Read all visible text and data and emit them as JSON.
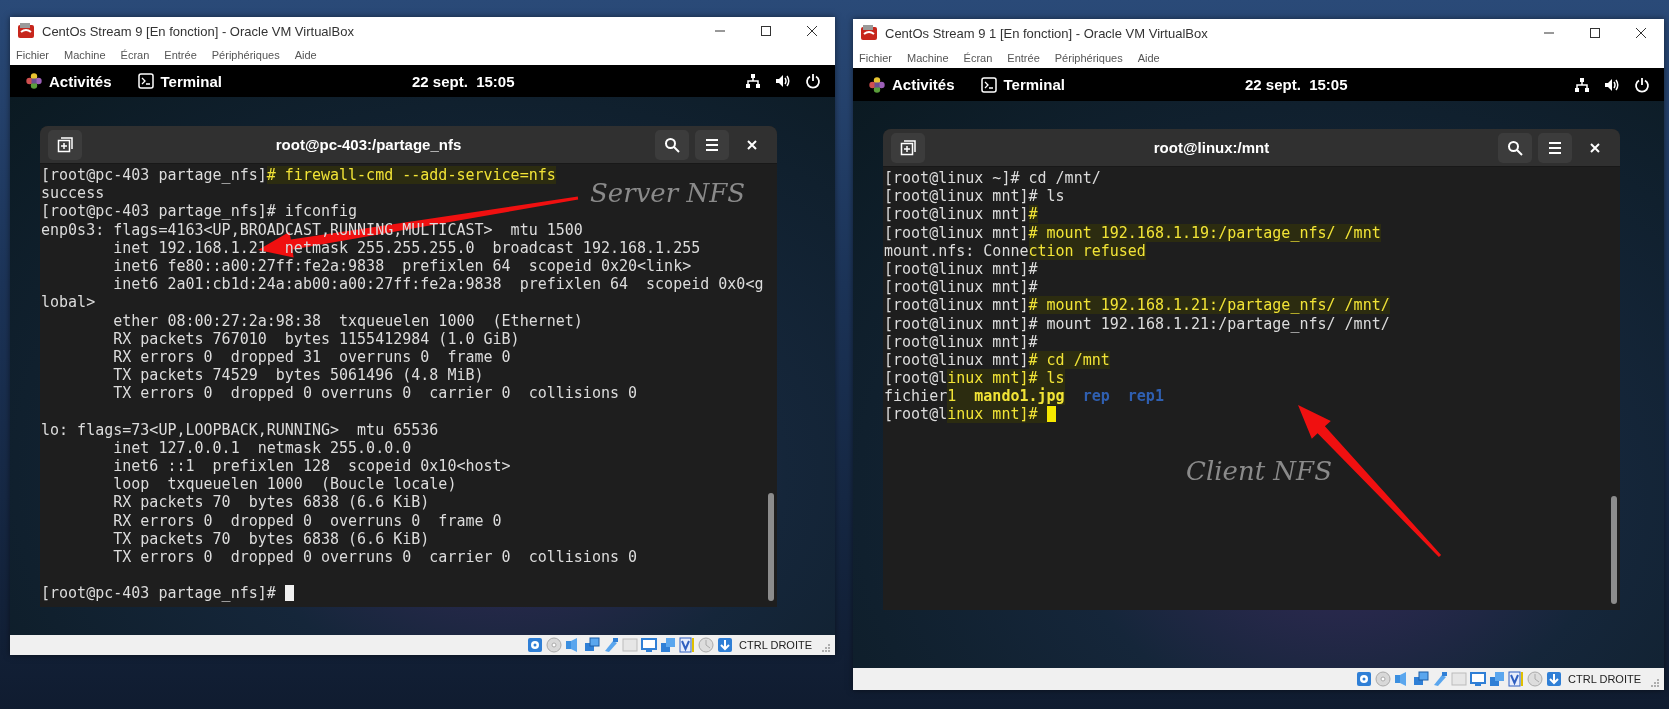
{
  "windows": [
    {
      "title": "CentOs Stream 9 [En fonction] - Oracle VM VirtualBox",
      "menu": [
        "Fichier",
        "Machine",
        "Écran",
        "Entrée",
        "Périphériques",
        "Aide"
      ],
      "top_bar": {
        "activities": "Activités",
        "app": "Terminal",
        "clock": "22 sept.  15:05"
      },
      "terminal": {
        "title": "root@pc-403:/partage_nfs",
        "lines": [
          {
            "kind": "parts",
            "parts": [
              {
                "text": "[root@pc-403 partage_nfs]",
                "kind": "text",
                "marked": false
              },
              {
                "text": "# firewall-cmd --add-service=nfs",
                "kind": "text",
                "marked": true
              }
            ]
          },
          {
            "kind": "plain",
            "text": "success"
          },
          {
            "kind": "plain",
            "text": "[root@pc-403 partage_nfs]# ifconfig"
          },
          {
            "kind": "plain",
            "text": "enp0s3: flags=4163<UP,BROADCAST,RUNNING,MULTICAST>  mtu 1500"
          },
          {
            "kind": "plain",
            "text": "        inet 192.168.1.21  netmask 255.255.255.0  broadcast 192.168.1.255"
          },
          {
            "kind": "plain",
            "text": "        inet6 fe80::a00:27ff:fe2a:9838  prefixlen 64  scopeid 0x20<link>"
          },
          {
            "kind": "plain",
            "text": "        inet6 2a01:cb1d:24a:ab00:a00:27ff:fe2a:9838  prefixlen 64  scopeid 0x0<g"
          },
          {
            "kind": "plain",
            "text": "lobal>"
          },
          {
            "kind": "plain",
            "text": "        ether 08:00:27:2a:98:38  txqueuelen 1000  (Ethernet)"
          },
          {
            "kind": "plain",
            "text": "        RX packets 767010  bytes 1155412984 (1.0 GiB)"
          },
          {
            "kind": "plain",
            "text": "        RX errors 0  dropped 31  overruns 0  frame 0"
          },
          {
            "kind": "plain",
            "text": "        TX packets 74529  bytes 5061496 (4.8 MiB)"
          },
          {
            "kind": "plain",
            "text": "        TX errors 0  dropped 0 overruns 0  carrier 0  collisions 0"
          },
          {
            "kind": "blank"
          },
          {
            "kind": "plain",
            "text": "lo: flags=73<UP,LOOPBACK,RUNNING>  mtu 65536"
          },
          {
            "kind": "plain",
            "text": "        inet 127.0.0.1  netmask 255.0.0.0"
          },
          {
            "kind": "plain",
            "text": "        inet6 ::1  prefixlen 128  scopeid 0x10<host>"
          },
          {
            "kind": "plain",
            "text": "        loop  txqueuelen 1000  (Boucle locale)"
          },
          {
            "kind": "plain",
            "text": "        RX packets 70  bytes 6838 (6.6 KiB)"
          },
          {
            "kind": "plain",
            "text": "        RX errors 0  dropped 0  overruns 0  frame 0"
          },
          {
            "kind": "plain",
            "text": "        TX packets 70  bytes 6838 (6.6 KiB)"
          },
          {
            "kind": "plain",
            "text": "        TX errors 0  dropped 0 overruns 0  carrier 0  collisions 0"
          },
          {
            "kind": "blank"
          },
          {
            "kind": "parts",
            "parts": [
              {
                "text": "[root@pc-403 partage_nfs]# ",
                "kind": "text",
                "marked": false
              },
              {
                "kind": "cursor",
                "marked": false
              }
            ]
          }
        ]
      },
      "annotation": {
        "text": "Server NFS"
      },
      "status_bar": {
        "host_key": "CTRL DROITE"
      }
    },
    {
      "title": "CentOs Stream 9 1 [En fonction] - Oracle VM VirtualBox",
      "menu": [
        "Fichier",
        "Machine",
        "Écran",
        "Entrée",
        "Périphériques",
        "Aide"
      ],
      "top_bar": {
        "activities": "Activités",
        "app": "Terminal",
        "clock": "22 sept.  15:05"
      },
      "terminal": {
        "title": "root@linux:/mnt",
        "lines": [
          {
            "kind": "plain",
            "text": "[root@linux ~]# cd /mnt/"
          },
          {
            "kind": "plain",
            "text": "[root@linux mnt]# ls"
          },
          {
            "kind": "parts",
            "parts": [
              {
                "text": "[root@linux mnt]",
                "kind": "text",
                "marked": false
              },
              {
                "text": "#",
                "kind": "text",
                "marked": true
              }
            ]
          },
          {
            "kind": "parts",
            "parts": [
              {
                "text": "[root@linux mnt]",
                "kind": "text",
                "marked": false
              },
              {
                "text": "# mount 192.168.1.19:/partage_nfs/ /mnt",
                "kind": "text",
                "marked": true
              }
            ]
          },
          {
            "kind": "parts",
            "parts": [
              {
                "text": "mount.nfs: Conne",
                "kind": "text",
                "marked": false
              },
              {
                "text": "ction refused",
                "kind": "text",
                "marked": true
              }
            ]
          },
          {
            "kind": "plain",
            "text": "[root@linux mnt]#"
          },
          {
            "kind": "plain",
            "text": "[root@linux mnt]#"
          },
          {
            "kind": "parts",
            "parts": [
              {
                "text": "[root@linux mnt]",
                "kind": "text",
                "marked": false
              },
              {
                "text": "# mount 192.168.1.21:/partage_nfs/ /mnt/",
                "kind": "text",
                "marked": true
              }
            ]
          },
          {
            "kind": "plain",
            "text": "[root@linux mnt]# mount 192.168.1.21:/partage_nfs/ /mnt/"
          },
          {
            "kind": "plain",
            "text": "[root@linux mnt]#"
          },
          {
            "kind": "parts",
            "parts": [
              {
                "text": "[root@linux mnt]",
                "kind": "text",
                "marked": false
              },
              {
                "text": "# cd /mnt",
                "kind": "text",
                "marked": true
              }
            ]
          },
          {
            "kind": "parts",
            "parts": [
              {
                "text": "[root@l",
                "kind": "text",
                "marked": false
              },
              {
                "text": "inux mnt]# ls",
                "kind": "text",
                "marked": true
              }
            ]
          },
          {
            "kind": "parts",
            "parts": [
              {
                "text": "fichier",
                "kind": "text",
                "marked": false
              },
              {
                "text": "1  ",
                "kind": "text",
                "marked": true
              },
              {
                "text": "mando1.jpg",
                "kind": "image_file",
                "marked": true
              },
              {
                "text": "rep",
                "kind": "directory",
                "marked": false
              },
              {
                "text": "rep1",
                "kind": "directory",
                "marked": false
              }
            ]
          },
          {
            "kind": "parts",
            "parts": [
              {
                "text": "[root@l",
                "kind": "text",
                "marked": false
              },
              {
                "text": "inux mnt]# ",
                "kind": "text",
                "marked": true
              },
              {
                "kind": "cursor",
                "marked": true
              }
            ]
          }
        ]
      },
      "annotation": {
        "text": "Client NFS"
      },
      "status_bar": {
        "host_key": "CTRL DROITE"
      }
    }
  ]
}
